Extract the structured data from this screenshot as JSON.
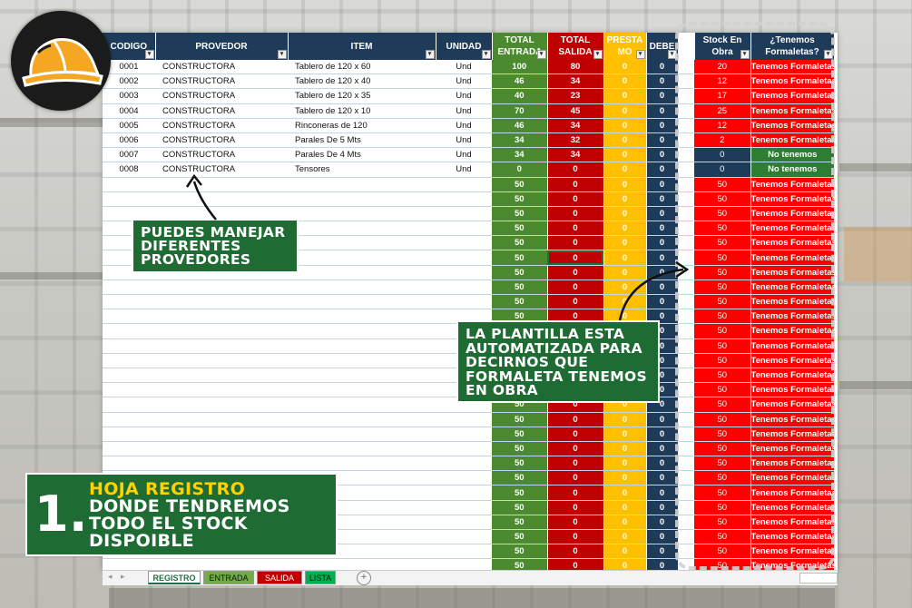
{
  "headers": {
    "codigo": "CODIGO",
    "proveedor": "PROVEDOR",
    "item": "ITEM",
    "unidad": "UNIDAD",
    "total_entrada_1": "TOTAL",
    "total_entrada_2": "ENTRADA",
    "total_salida_1": "TOTAL",
    "total_salida_2": "SALIDA",
    "prestamo_1": "PRESTA",
    "prestamo_2": "MO",
    "debe": "DEBE",
    "stock_1": "Stock En",
    "stock_2": "Obra",
    "tenemos_1": "¿Tenemos",
    "tenemos_2": "Formaletas?"
  },
  "rows": [
    {
      "codigo": "0001",
      "proveedor": "CONSTRUCTORA",
      "item": "Tablero de 120 x 60",
      "unidad": "Und",
      "entrada": "100",
      "salida": "80",
      "prestamo": "0",
      "debe": "0",
      "stock": "20",
      "tenemos": "Tenemos Formaletas",
      "status": "red"
    },
    {
      "codigo": "0002",
      "proveedor": "CONSTRUCTORA",
      "item": "Tablero de 120 x 40",
      "unidad": "Und",
      "entrada": "46",
      "salida": "34",
      "prestamo": "0",
      "debe": "0",
      "stock": "12",
      "tenemos": "Tenemos Formaletas",
      "status": "red"
    },
    {
      "codigo": "0003",
      "proveedor": "CONSTRUCTORA",
      "item": "Tablero de 120 x 35",
      "unidad": "Und",
      "entrada": "40",
      "salida": "23",
      "prestamo": "0",
      "debe": "0",
      "stock": "17",
      "tenemos": "Tenemos Formaletas",
      "status": "red"
    },
    {
      "codigo": "0004",
      "proveedor": "CONSTRUCTORA",
      "item": "Tablero de 120 x 10",
      "unidad": "Und",
      "entrada": "70",
      "salida": "45",
      "prestamo": "0",
      "debe": "0",
      "stock": "25",
      "tenemos": "Tenemos Formaletas",
      "status": "red"
    },
    {
      "codigo": "0005",
      "proveedor": "CONSTRUCTORA",
      "item": "Rinconeras de 120",
      "unidad": "Und",
      "entrada": "46",
      "salida": "34",
      "prestamo": "0",
      "debe": "0",
      "stock": "12",
      "tenemos": "Tenemos Formaletas",
      "status": "red"
    },
    {
      "codigo": "0006",
      "proveedor": "CONSTRUCTORA",
      "item": "Parales De 5 Mts",
      "unidad": "Und",
      "entrada": "34",
      "salida": "32",
      "prestamo": "0",
      "debe": "0",
      "stock": "2",
      "tenemos": "Tenemos Formaletas",
      "status": "red"
    },
    {
      "codigo": "0007",
      "proveedor": "CONSTRUCTORA",
      "item": "Parales De 4 Mts",
      "unidad": "Und",
      "entrada": "34",
      "salida": "34",
      "prestamo": "0",
      "debe": "0",
      "stock": "0",
      "tenemos": "No tenemos",
      "status": "green"
    },
    {
      "codigo": "0008",
      "proveedor": "CONSTRUCTORA",
      "item": "Tensores",
      "unidad": "Und",
      "entrada": "0",
      "salida": "0",
      "prestamo": "0",
      "debe": "0",
      "stock": "0",
      "tenemos": "No tenemos",
      "status": "green"
    }
  ],
  "empty_row": {
    "entrada": "50",
    "salida": "0",
    "prestamo": "0",
    "debe": "0",
    "stock": "50",
    "tenemos": "Tenemos Formaletas"
  },
  "empty_row_count": 28,
  "tabs": {
    "registro": "REGISTRO",
    "entrada": "ENTRADA",
    "salida": "SALIDA",
    "lista": "LISTA"
  },
  "callouts": {
    "proveedores": "PUEDES MANEJAR DIFERENTES PROVEDORES",
    "automatizada": "LA PLANTILLA ESTA AUTOMATIZADA PARA DECIRNOS QUE FORMALETA TENEMOS EN OBRA",
    "registro_number": "1.",
    "registro_title": "HOJA REGISTRO",
    "registro_body": "DONDE TENDREMOS TODO EL STOCK DISPOIBLE"
  },
  "colors": {
    "navy": "#1f3b5a",
    "green": "#4b8a2f",
    "red": "#c00000",
    "yellow": "#ffc000",
    "stock_red": "#ff0000",
    "callout_green": "#1e6b33",
    "accent_yellow": "#ffd200"
  }
}
